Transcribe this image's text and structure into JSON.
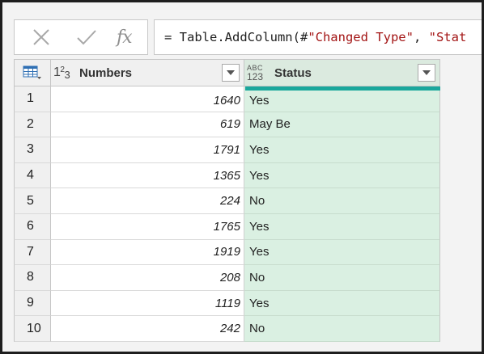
{
  "formula_bar": {
    "cancel_icon": "x-icon",
    "confirm_icon": "check-icon",
    "fx_label": "fx",
    "formula_prefix": "= Table.AddColumn(#",
    "formula_str1": "\"Changed Type\"",
    "formula_sep": ", ",
    "formula_str2": "\"Stat"
  },
  "table": {
    "corner_icon": "table-menu-icon",
    "columns": [
      {
        "type_icon": "whole-number-type-icon",
        "label": "Numbers"
      },
      {
        "type_icon": "any-type-icon",
        "type_top": "ABC",
        "type_bottom": "123",
        "label": "Status"
      }
    ],
    "rows": [
      {
        "index": "1",
        "number": "1640",
        "status": "Yes"
      },
      {
        "index": "2",
        "number": "619",
        "status": "May Be"
      },
      {
        "index": "3",
        "number": "1791",
        "status": "Yes"
      },
      {
        "index": "4",
        "number": "1365",
        "status": "Yes"
      },
      {
        "index": "5",
        "number": "224",
        "status": "No"
      },
      {
        "index": "6",
        "number": "1765",
        "status": "Yes"
      },
      {
        "index": "7",
        "number": "1919",
        "status": "Yes"
      },
      {
        "index": "8",
        "number": "208",
        "status": "No"
      },
      {
        "index": "9",
        "number": "1119",
        "status": "Yes"
      },
      {
        "index": "10",
        "number": "242",
        "status": "No"
      }
    ]
  },
  "colors": {
    "selected_column_bg": "#daf0e2",
    "selected_column_accent": "#1aa79c",
    "formula_string": "#a31515"
  }
}
